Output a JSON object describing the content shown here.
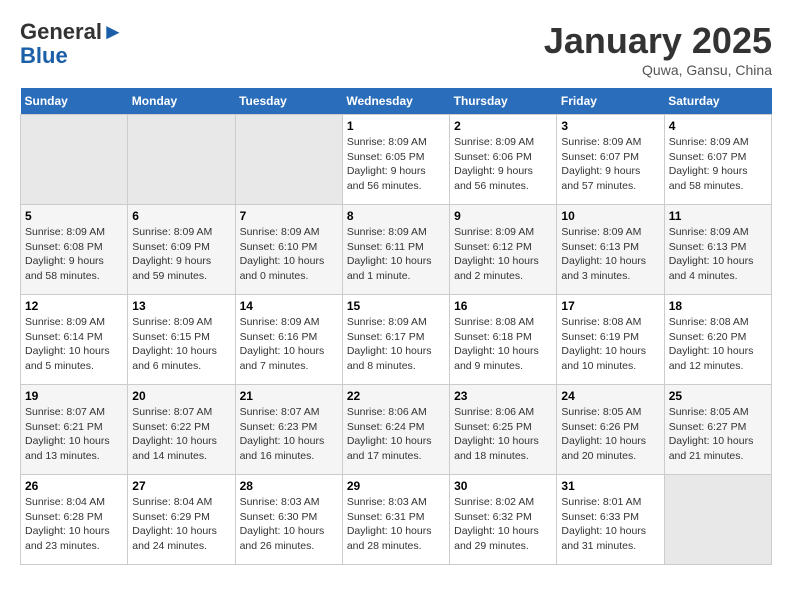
{
  "header": {
    "logo_general": "General",
    "logo_blue": "Blue",
    "month_title": "January 2025",
    "subtitle": "Quwa, Gansu, China"
  },
  "weekdays": [
    "Sunday",
    "Monday",
    "Tuesday",
    "Wednesday",
    "Thursday",
    "Friday",
    "Saturday"
  ],
  "weeks": [
    [
      {
        "day": "",
        "info": ""
      },
      {
        "day": "",
        "info": ""
      },
      {
        "day": "",
        "info": ""
      },
      {
        "day": "1",
        "info": "Sunrise: 8:09 AM\nSunset: 6:05 PM\nDaylight: 9 hours and 56 minutes."
      },
      {
        "day": "2",
        "info": "Sunrise: 8:09 AM\nSunset: 6:06 PM\nDaylight: 9 hours and 56 minutes."
      },
      {
        "day": "3",
        "info": "Sunrise: 8:09 AM\nSunset: 6:07 PM\nDaylight: 9 hours and 57 minutes."
      },
      {
        "day": "4",
        "info": "Sunrise: 8:09 AM\nSunset: 6:07 PM\nDaylight: 9 hours and 58 minutes."
      }
    ],
    [
      {
        "day": "5",
        "info": "Sunrise: 8:09 AM\nSunset: 6:08 PM\nDaylight: 9 hours and 58 minutes."
      },
      {
        "day": "6",
        "info": "Sunrise: 8:09 AM\nSunset: 6:09 PM\nDaylight: 9 hours and 59 minutes."
      },
      {
        "day": "7",
        "info": "Sunrise: 8:09 AM\nSunset: 6:10 PM\nDaylight: 10 hours and 0 minutes."
      },
      {
        "day": "8",
        "info": "Sunrise: 8:09 AM\nSunset: 6:11 PM\nDaylight: 10 hours and 1 minute."
      },
      {
        "day": "9",
        "info": "Sunrise: 8:09 AM\nSunset: 6:12 PM\nDaylight: 10 hours and 2 minutes."
      },
      {
        "day": "10",
        "info": "Sunrise: 8:09 AM\nSunset: 6:13 PM\nDaylight: 10 hours and 3 minutes."
      },
      {
        "day": "11",
        "info": "Sunrise: 8:09 AM\nSunset: 6:13 PM\nDaylight: 10 hours and 4 minutes."
      }
    ],
    [
      {
        "day": "12",
        "info": "Sunrise: 8:09 AM\nSunset: 6:14 PM\nDaylight: 10 hours and 5 minutes."
      },
      {
        "day": "13",
        "info": "Sunrise: 8:09 AM\nSunset: 6:15 PM\nDaylight: 10 hours and 6 minutes."
      },
      {
        "day": "14",
        "info": "Sunrise: 8:09 AM\nSunset: 6:16 PM\nDaylight: 10 hours and 7 minutes."
      },
      {
        "day": "15",
        "info": "Sunrise: 8:09 AM\nSunset: 6:17 PM\nDaylight: 10 hours and 8 minutes."
      },
      {
        "day": "16",
        "info": "Sunrise: 8:08 AM\nSunset: 6:18 PM\nDaylight: 10 hours and 9 minutes."
      },
      {
        "day": "17",
        "info": "Sunrise: 8:08 AM\nSunset: 6:19 PM\nDaylight: 10 hours and 10 minutes."
      },
      {
        "day": "18",
        "info": "Sunrise: 8:08 AM\nSunset: 6:20 PM\nDaylight: 10 hours and 12 minutes."
      }
    ],
    [
      {
        "day": "19",
        "info": "Sunrise: 8:07 AM\nSunset: 6:21 PM\nDaylight: 10 hours and 13 minutes."
      },
      {
        "day": "20",
        "info": "Sunrise: 8:07 AM\nSunset: 6:22 PM\nDaylight: 10 hours and 14 minutes."
      },
      {
        "day": "21",
        "info": "Sunrise: 8:07 AM\nSunset: 6:23 PM\nDaylight: 10 hours and 16 minutes."
      },
      {
        "day": "22",
        "info": "Sunrise: 8:06 AM\nSunset: 6:24 PM\nDaylight: 10 hours and 17 minutes."
      },
      {
        "day": "23",
        "info": "Sunrise: 8:06 AM\nSunset: 6:25 PM\nDaylight: 10 hours and 18 minutes."
      },
      {
        "day": "24",
        "info": "Sunrise: 8:05 AM\nSunset: 6:26 PM\nDaylight: 10 hours and 20 minutes."
      },
      {
        "day": "25",
        "info": "Sunrise: 8:05 AM\nSunset: 6:27 PM\nDaylight: 10 hours and 21 minutes."
      }
    ],
    [
      {
        "day": "26",
        "info": "Sunrise: 8:04 AM\nSunset: 6:28 PM\nDaylight: 10 hours and 23 minutes."
      },
      {
        "day": "27",
        "info": "Sunrise: 8:04 AM\nSunset: 6:29 PM\nDaylight: 10 hours and 24 minutes."
      },
      {
        "day": "28",
        "info": "Sunrise: 8:03 AM\nSunset: 6:30 PM\nDaylight: 10 hours and 26 minutes."
      },
      {
        "day": "29",
        "info": "Sunrise: 8:03 AM\nSunset: 6:31 PM\nDaylight: 10 hours and 28 minutes."
      },
      {
        "day": "30",
        "info": "Sunrise: 8:02 AM\nSunset: 6:32 PM\nDaylight: 10 hours and 29 minutes."
      },
      {
        "day": "31",
        "info": "Sunrise: 8:01 AM\nSunset: 6:33 PM\nDaylight: 10 hours and 31 minutes."
      },
      {
        "day": "",
        "info": ""
      }
    ]
  ]
}
